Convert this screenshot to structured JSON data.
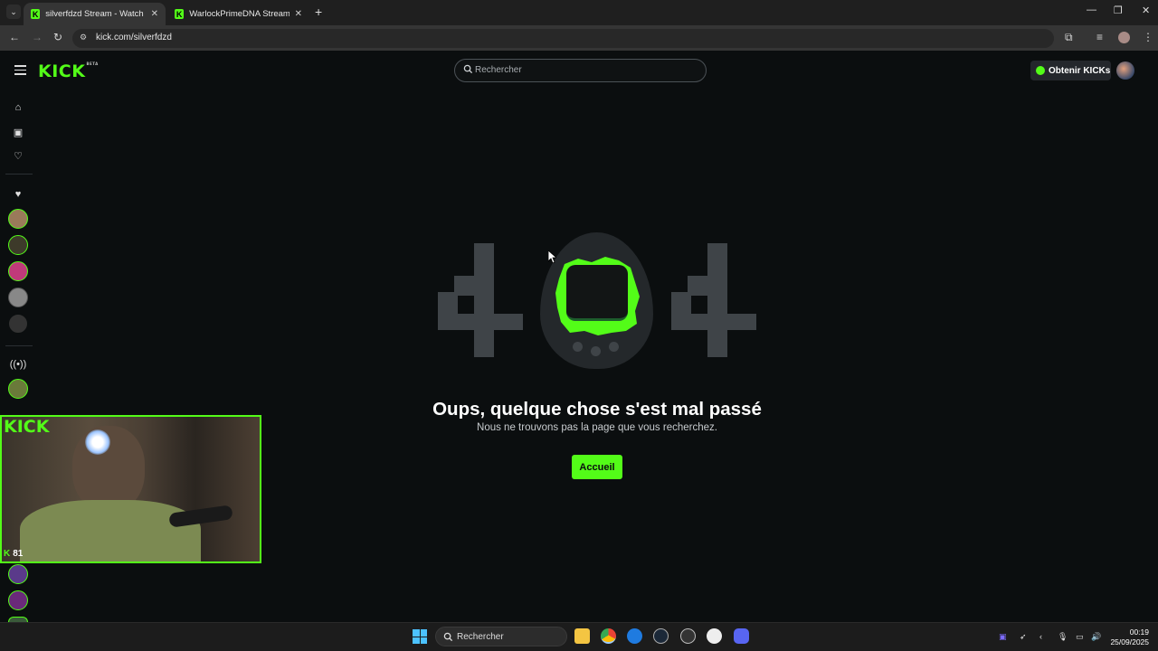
{
  "browser": {
    "tabs": [
      {
        "title": "silverfdzd Stream - Watch Live o",
        "favicon": "K",
        "active": true
      },
      {
        "title": "WarlockPrimeDNA Stream - Wa",
        "favicon": "K",
        "active": false
      }
    ],
    "new_tab": "+",
    "url": "kick.com/silverfdzd"
  },
  "header": {
    "logo": "KICK",
    "logo_badge": "BETA",
    "search_placeholder": "Rechercher",
    "kicks_button": "Obtenir KICKs"
  },
  "error": {
    "title": "Oups, quelque chose s'est mal passé",
    "subtitle": "Nous ne trouvons pas la page que vous recherchez.",
    "home_button": "Accueil"
  },
  "overlay": {
    "logo": "KICK",
    "viewers": "81"
  },
  "taskbar": {
    "search_placeholder": "Rechercher",
    "time": "00:19",
    "date": "25/09/2025"
  },
  "colors": {
    "accent": "#53fc18",
    "background": "#0b0e0f"
  }
}
